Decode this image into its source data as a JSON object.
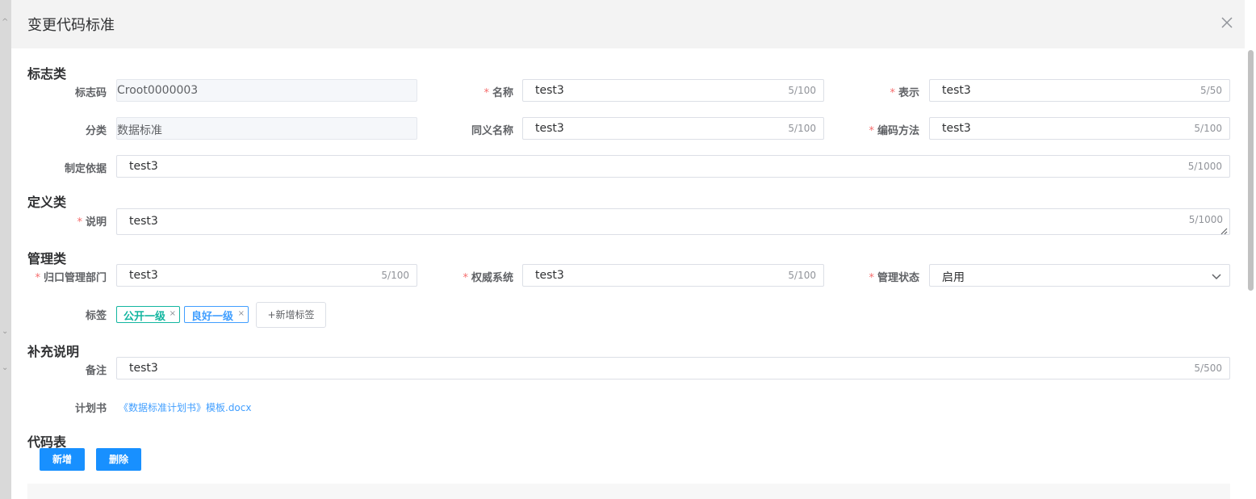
{
  "dialog": {
    "title": "变更代码标准"
  },
  "sections": {
    "flag": "标志类",
    "definition": "定义类",
    "management": "管理类",
    "supplement": "补充说明",
    "code_table": "代码表"
  },
  "fields": {
    "flag_code": {
      "label": "标志码",
      "value": "Croot0000003"
    },
    "name": {
      "label": "名称",
      "value": "test3",
      "count": "5/100",
      "required": true
    },
    "representation": {
      "label": "表示",
      "value": "test3",
      "count": "5/50",
      "required": true
    },
    "category": {
      "label": "分类",
      "value": "数据标准"
    },
    "synonym": {
      "label": "同义名称",
      "value": "test3",
      "count": "5/100"
    },
    "encoding": {
      "label": "编码方法",
      "value": "test3",
      "count": "5/100",
      "required": true
    },
    "basis": {
      "label": "制定依据",
      "value": "test3",
      "count": "5/1000"
    },
    "description": {
      "label": "说明",
      "value": "test3",
      "count": "5/1000",
      "required": true
    },
    "department": {
      "label": "归口管理部门",
      "value": "test3",
      "count": "5/100",
      "required": true
    },
    "authority": {
      "label": "权威系统",
      "value": "test3",
      "count": "5/100",
      "required": true
    },
    "status": {
      "label": "管理状态",
      "value": "启用",
      "required": true
    },
    "tags": {
      "label": "标签",
      "items": [
        {
          "text": "公开一级",
          "color": "#13b6a0"
        },
        {
          "text": "良好一级",
          "color": "#409eff"
        }
      ],
      "add_label": "+新增标签"
    },
    "remark": {
      "label": "备注",
      "value": "test3",
      "count": "5/500"
    },
    "plan": {
      "label": "计划书",
      "link": "《数据标准计划书》模板.docx"
    }
  },
  "buttons": {
    "add": "新增",
    "delete": "删除"
  },
  "icons": {
    "close": "close-icon",
    "dropdown": "chevron-down-icon",
    "resize": "resize-handle-icon"
  },
  "colors": {
    "required": "#f56c6c",
    "primary": "#1890ff",
    "link": "#409eff"
  }
}
